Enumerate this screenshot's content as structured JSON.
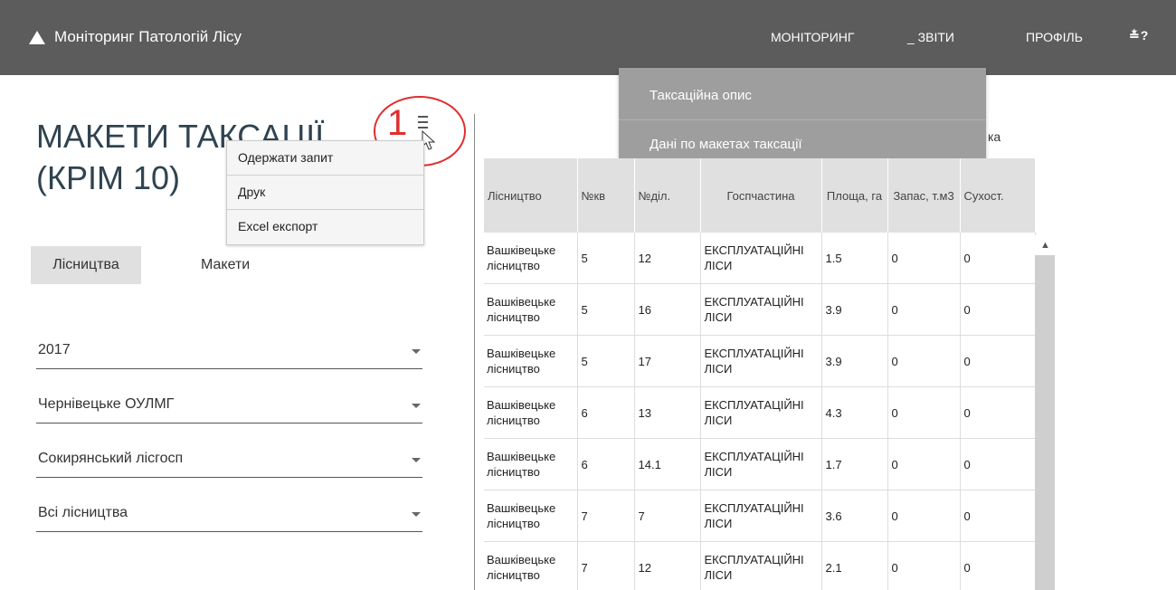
{
  "header": {
    "app_title": "Моніторинг Патологій Лісу",
    "nav": [
      "МОНІТОРИНГ",
      "_ ЗВІТИ",
      "ПРОФІЛЬ"
    ],
    "icons_text": "≛?",
    "icon_names": [
      "download-icon",
      "help-icon"
    ]
  },
  "reports_menu": {
    "items": [
      "Таксаційна опис",
      "Дані по макетах таксації"
    ]
  },
  "page": {
    "title_line1": "МАКЕТИ ТАКСАЦІЇ",
    "title_line2": "(КРІМ 10)",
    "callout_number": "1"
  },
  "context_menu": {
    "items": [
      "Одержати запит",
      "Друк",
      "Excel експорт"
    ]
  },
  "tabs": [
    "Лісництва",
    "Макети"
  ],
  "filters": [
    "2017",
    "Чернівецьке ОУЛМГ",
    "Сокирянський лісгосп",
    "Всі лісництва"
  ],
  "panel_label": "ка",
  "table": {
    "columns": [
      "Лісництво",
      "№кв",
      "№діл.",
      "Госпчастина",
      "Площа, га",
      "Запас, т.м3",
      "Сухост."
    ],
    "rows": [
      [
        "Вашківецьке лісництво",
        "5",
        "12",
        "ЕКСПЛУАТАЦІЙНІ ЛІСИ",
        "1.5",
        "0",
        "0"
      ],
      [
        "Вашківецьке лісництво",
        "5",
        "16",
        "ЕКСПЛУАТАЦІЙНІ ЛІСИ",
        "3.9",
        "0",
        "0"
      ],
      [
        "Вашківецьке лісництво",
        "5",
        "17",
        "ЕКСПЛУАТАЦІЙНІ ЛІСИ",
        "3.9",
        "0",
        "0"
      ],
      [
        "Вашківецьке лісництво",
        "6",
        "13",
        "ЕКСПЛУАТАЦІЙНІ ЛІСИ",
        "4.3",
        "0",
        "0"
      ],
      [
        "Вашківецьке лісництво",
        "6",
        "14.1",
        "ЕКСПЛУАТАЦІЙНІ ЛІСИ",
        "1.7",
        "0",
        "0"
      ],
      [
        "Вашківецьке лісництво",
        "7",
        "7",
        "ЕКСПЛУАТАЦІЙНІ ЛІСИ",
        "3.6",
        "0",
        "0"
      ],
      [
        "Вашківецьке лісництво",
        "7",
        "12",
        "ЕКСПЛУАТАЦІЙНІ ЛІСИ",
        "2.1",
        "0",
        "0"
      ]
    ]
  },
  "colors": {
    "topbar": "#5c5c5c",
    "dropdown": "#9e9e9e",
    "title": "#2f4350",
    "callout": "#e12e2e"
  }
}
